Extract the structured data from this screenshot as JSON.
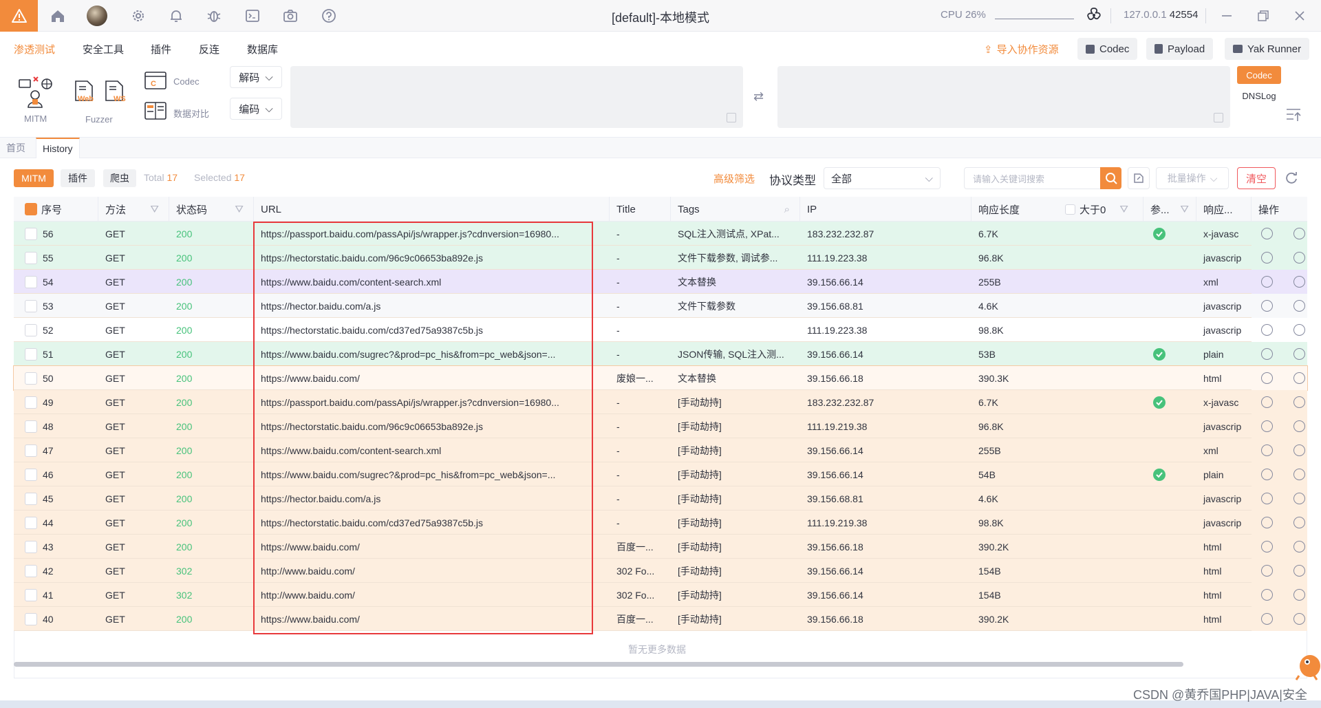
{
  "window": {
    "title": "[default]-本地模式",
    "cpu_label": "CPU",
    "cpu_value": "26%",
    "host": "127.0.0.1",
    "port": "42554"
  },
  "menu": {
    "items": [
      "渗透测试",
      "安全工具",
      "插件",
      "反连",
      "数据库"
    ],
    "import_label": "导入协作资源",
    "codec": "Codec",
    "payload": "Payload",
    "yak_runner": "Yak Runner"
  },
  "tools": {
    "mitm": "MITM",
    "fuzzer": "Fuzzer",
    "web": "Web",
    "ws": "WS",
    "codec": "Codec",
    "compare": "数据对比",
    "decode": "解码",
    "encode": "编码",
    "side_codec": "Codec",
    "side_dnslog": "DNSLog"
  },
  "tabs": [
    "首页",
    "History"
  ],
  "filter": {
    "mitm": "MITM",
    "plugin": "插件",
    "crawler": "爬虫",
    "total_label": "Total",
    "total": "17",
    "selected_label": "Selected",
    "selected": "17",
    "advanced": "高级筛选",
    "protocol_label": "协议类型",
    "protocol_value": "全部",
    "search_placeholder": "请输入关键词搜索",
    "batch": "批量操作",
    "clear": "清空"
  },
  "columns": {
    "id": "序号",
    "method": "方法",
    "status": "状态码",
    "url": "URL",
    "title": "Title",
    "tags": "Tags",
    "ip": "IP",
    "length": "响应长度",
    "gt0": "大于0",
    "params": "参...",
    "resp_type": "响应...",
    "action": "操作"
  },
  "rows": [
    {
      "id": "56",
      "method": "GET",
      "status": "200",
      "url": "https://passport.baidu.com/passApi/js/wrapper.js?cdnversion=16980...",
      "title": "-",
      "tags": "SQL注入测试点, XPat...",
      "ip": "183.232.232.87",
      "length": "6.7K",
      "param": true,
      "type": "x-javasc",
      "bg": "#e3f6ec"
    },
    {
      "id": "55",
      "method": "GET",
      "status": "200",
      "url": "https://hectorstatic.baidu.com/96c9c06653ba892e.js",
      "title": "-",
      "tags": "文件下载参数, 调试参...",
      "ip": "111.19.223.38",
      "length": "96.8K",
      "param": false,
      "type": "javascrip",
      "bg": "#e3f6ec"
    },
    {
      "id": "54",
      "method": "GET",
      "status": "200",
      "url": "https://www.baidu.com/content-search.xml",
      "title": "-",
      "tags": "文本替换",
      "ip": "39.156.66.14",
      "length": "255B",
      "param": false,
      "type": "xml",
      "bg": "#ebe5fb"
    },
    {
      "id": "53",
      "method": "GET",
      "status": "200",
      "url": "https://hector.baidu.com/a.js",
      "title": "-",
      "tags": "文件下载参数",
      "ip": "39.156.68.81",
      "length": "4.6K",
      "param": false,
      "type": "javascrip",
      "bg": "#f7f8fa"
    },
    {
      "id": "52",
      "method": "GET",
      "status": "200",
      "url": "https://hectorstatic.baidu.com/cd37ed75a9387c5b.js",
      "title": "-",
      "tags": "",
      "ip": "111.19.223.38",
      "length": "98.8K",
      "param": false,
      "type": "javascrip",
      "bg": "#ffffff"
    },
    {
      "id": "51",
      "method": "GET",
      "status": "200",
      "url": "https://www.baidu.com/sugrec?&prod=pc_his&from=pc_web&json=...",
      "title": "-",
      "tags": "JSON传输, SQL注入测...",
      "ip": "39.156.66.14",
      "length": "53B",
      "param": true,
      "type": "plain",
      "bg": "#e3f6ec"
    },
    {
      "id": "50",
      "method": "GET",
      "status": "200",
      "url": "https://www.baidu.com/",
      "title": "废娘一...",
      "tags": "文本替换",
      "ip": "39.156.66.18",
      "length": "390.3K",
      "param": false,
      "type": "html",
      "bg": "#fff7f0"
    },
    {
      "id": "49",
      "method": "GET",
      "status": "200",
      "url": "https://passport.baidu.com/passApi/js/wrapper.js?cdnversion=16980...",
      "title": "-",
      "tags": "[手动劫持]",
      "ip": "183.232.232.87",
      "length": "6.7K",
      "param": true,
      "type": "x-javasc",
      "bg": "#fdeedf"
    },
    {
      "id": "48",
      "method": "GET",
      "status": "200",
      "url": "https://hectorstatic.baidu.com/96c9c06653ba892e.js",
      "title": "-",
      "tags": "[手动劫持]",
      "ip": "111.19.219.38",
      "length": "96.8K",
      "param": false,
      "type": "javascrip",
      "bg": "#fdeedf"
    },
    {
      "id": "47",
      "method": "GET",
      "status": "200",
      "url": "https://www.baidu.com/content-search.xml",
      "title": "-",
      "tags": "[手动劫持]",
      "ip": "39.156.66.14",
      "length": "255B",
      "param": false,
      "type": "xml",
      "bg": "#fdeedf"
    },
    {
      "id": "46",
      "method": "GET",
      "status": "200",
      "url": "https://www.baidu.com/sugrec?&prod=pc_his&from=pc_web&json=...",
      "title": "-",
      "tags": "[手动劫持]",
      "ip": "39.156.66.14",
      "length": "54B",
      "param": true,
      "type": "plain",
      "bg": "#fdeedf"
    },
    {
      "id": "45",
      "method": "GET",
      "status": "200",
      "url": "https://hector.baidu.com/a.js",
      "title": "-",
      "tags": "[手动劫持]",
      "ip": "39.156.68.81",
      "length": "4.6K",
      "param": false,
      "type": "javascrip",
      "bg": "#fdeedf"
    },
    {
      "id": "44",
      "method": "GET",
      "status": "200",
      "url": "https://hectorstatic.baidu.com/cd37ed75a9387c5b.js",
      "title": "-",
      "tags": "[手动劫持]",
      "ip": "111.19.219.38",
      "length": "98.8K",
      "param": false,
      "type": "javascrip",
      "bg": "#fdeedf"
    },
    {
      "id": "43",
      "method": "GET",
      "status": "200",
      "url": "https://www.baidu.com/",
      "title": "百度一...",
      "tags": "[手动劫持]",
      "ip": "39.156.66.18",
      "length": "390.2K",
      "param": false,
      "type": "html",
      "bg": "#fdeedf"
    },
    {
      "id": "42",
      "method": "GET",
      "status": "302",
      "url": "http://www.baidu.com/",
      "title": "302 Fo...",
      "tags": "[手动劫持]",
      "ip": "39.156.66.14",
      "length": "154B",
      "param": false,
      "type": "html",
      "bg": "#fdeedf"
    },
    {
      "id": "41",
      "method": "GET",
      "status": "302",
      "url": "http://www.baidu.com/",
      "title": "302 Fo...",
      "tags": "[手动劫持]",
      "ip": "39.156.66.14",
      "length": "154B",
      "param": false,
      "type": "html",
      "bg": "#fdeedf"
    },
    {
      "id": "40",
      "method": "GET",
      "status": "200",
      "url": "https://www.baidu.com/",
      "title": "百度一...",
      "tags": "[手动劫持]",
      "ip": "39.156.66.18",
      "length": "390.2K",
      "param": false,
      "type": "html",
      "bg": "#fdeedf"
    }
  ],
  "no_more": "暂无更多数据",
  "watermark": "CSDN @黄乔国PHP|JAVA|安全",
  "colors": {
    "accent": "#f28b3c",
    "status_ok": "#47c27b",
    "danger": "#e8393b"
  }
}
